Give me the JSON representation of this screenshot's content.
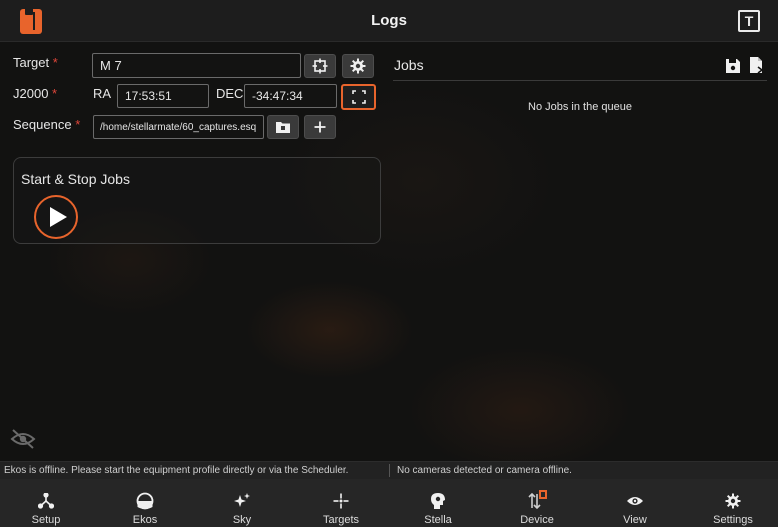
{
  "header": {
    "title": "Logs",
    "right_icon_letter": "T"
  },
  "form": {
    "target_label": "Target",
    "target_value": "M 7",
    "j2000_label": "J2000",
    "ra_label": "RA",
    "ra_value": "17:53:51",
    "dec_label": "DEC",
    "dec_value": "-34:47:34",
    "sequence_label": "Sequence",
    "sequence_value": "/home/stellarmate/60_captures.esq",
    "required_mark": "*"
  },
  "jobs_card": {
    "title": "Start & Stop Jobs"
  },
  "jobs_panel": {
    "title": "Jobs",
    "empty_text": "No Jobs in the queue"
  },
  "status": {
    "left": "Ekos is offline. Please start the equipment profile directly or via the Scheduler.",
    "right": "No cameras detected or camera offline."
  },
  "nav": [
    {
      "label": "Setup",
      "icon": "setup-icon"
    },
    {
      "label": "Ekos",
      "icon": "ekos-icon"
    },
    {
      "label": "Sky",
      "icon": "sky-icon"
    },
    {
      "label": "Targets",
      "icon": "targets-icon"
    },
    {
      "label": "Stella",
      "icon": "stella-icon"
    },
    {
      "label": "Device",
      "icon": "device-icon"
    },
    {
      "label": "View",
      "icon": "view-icon"
    },
    {
      "label": "Settings",
      "icon": "settings-icon"
    }
  ],
  "colors": {
    "accent": "#e8642c",
    "required": "#e0463a",
    "background": "#121211"
  }
}
